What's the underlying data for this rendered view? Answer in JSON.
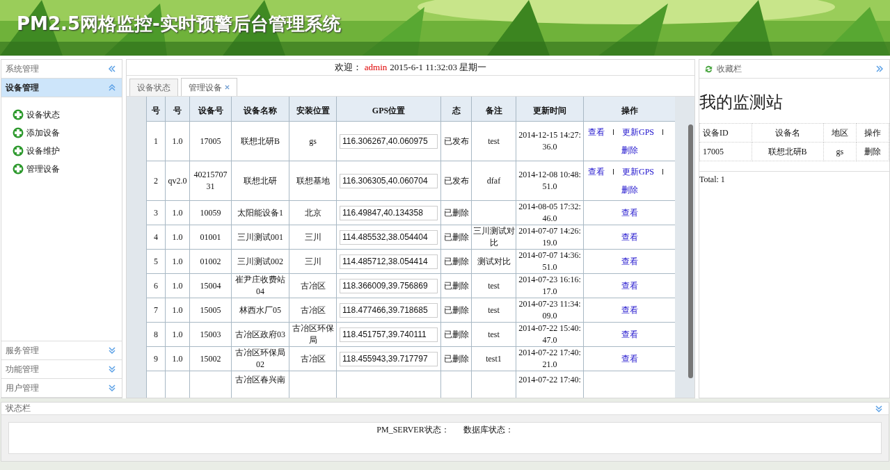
{
  "header": {
    "title": "PM2.5网格监控-实时预警后台管理系统"
  },
  "sidebar": {
    "title": "系统管理",
    "sections": [
      {
        "label": "设备管理",
        "expanded": true,
        "items": [
          "设备状态",
          "添加设备",
          "设备维护",
          "管理设备"
        ]
      },
      {
        "label": "服务管理",
        "expanded": false
      },
      {
        "label": "功能管理",
        "expanded": false
      },
      {
        "label": "用户管理",
        "expanded": false
      }
    ]
  },
  "welcome": {
    "label": "欢迎：",
    "user": "admin",
    "datetime": "2015-6-1 11:32:03 星期一"
  },
  "tabs": [
    {
      "label": "设备状态",
      "selected": false,
      "closable": false
    },
    {
      "label": "管理设备",
      "selected": true,
      "closable": true
    }
  ],
  "table": {
    "columns": [
      "号",
      "号",
      "设备号",
      "设备名称",
      "安装位置",
      "GPS位置",
      "态",
      "备注",
      "更新时间",
      "操作"
    ],
    "rows": [
      {
        "no": "1",
        "version": "1.0",
        "id": "17005",
        "name": "联想北研B",
        "location": "gs",
        "gps": "116.306267,40.060975",
        "status": "已发布",
        "remark": "test",
        "updated": "2014-12-15 14:27:36.0",
        "actions": [
          "查看",
          "更新GPS",
          "删除"
        ]
      },
      {
        "no": "2",
        "version": "qv2.0",
        "id": "4021570731",
        "name": "联想北研",
        "location": "联想基地",
        "gps": "116.306305,40.060704",
        "status": "已发布",
        "remark": "dfaf",
        "updated": "2014-12-08 10:48:51.0",
        "actions": [
          "查看",
          "更新GPS",
          "删除"
        ]
      },
      {
        "no": "3",
        "version": "1.0",
        "id": "10059",
        "name": "太阳能设备1",
        "location": "北京",
        "gps": "116.49847,40.134358",
        "status": "已删除",
        "updated": "2014-08-05 17:32:46.0",
        "actions": [
          "查看"
        ]
      },
      {
        "no": "4",
        "version": "1.0",
        "id": "01001",
        "name": "三川测试001",
        "location": "三川",
        "gps": "114.485532,38.054404",
        "status": "已删除",
        "remark": "三川测试对比",
        "updated": "2014-07-07 14:26:19.0",
        "actions": [
          "查看"
        ]
      },
      {
        "no": "5",
        "version": "1.0",
        "id": "01002",
        "name": "三川测试002",
        "location": "三川",
        "gps": "114.485712,38.054414",
        "status": "已删除",
        "remark": "测试对比",
        "updated": "2014-07-07 14:36:51.0",
        "actions": [
          "查看"
        ]
      },
      {
        "no": "6",
        "version": "1.0",
        "id": "15004",
        "name": "崔尹庄收费站04",
        "location": "古冶区",
        "gps": "118.366009,39.756869",
        "status": "已删除",
        "remark": "test",
        "updated": "2014-07-23 16:16:17.0",
        "actions": [
          "查看"
        ]
      },
      {
        "no": "7",
        "version": "1.0",
        "id": "15005",
        "name": "林西水厂05",
        "location": "古冶区",
        "gps": "118.477466,39.718685",
        "status": "已删除",
        "remark": "test",
        "updated": "2014-07-23 11:34:09.0",
        "actions": [
          "查看"
        ]
      },
      {
        "no": "8",
        "version": "1.0",
        "id": "15003",
        "name": "古冶区政府03",
        "location": "古冶区环保局",
        "gps": "118.451757,39.740111",
        "status": "已删除",
        "remark": "test",
        "updated": "2014-07-22 15:40:47.0",
        "actions": [
          "查看"
        ]
      },
      {
        "no": "9",
        "version": "1.0",
        "id": "15002",
        "name": "古冶区环保局02",
        "location": "古冶区",
        "gps": "118.455943,39.717797",
        "status": "已删除",
        "remark": "test1",
        "updated": "2014-07-22 17:40:21.0",
        "actions": [
          "查看"
        ]
      },
      {
        "name": "古冶区春兴南",
        "updated": "2014-07-22 17:40:"
      }
    ]
  },
  "favorites": {
    "title": "收藏栏",
    "heading": "我的监测站",
    "columns": [
      "设备ID",
      "设备名",
      "地区",
      "操作"
    ],
    "rows": [
      {
        "id": "17005",
        "name": "联想北研B",
        "region": "gs",
        "action": "删除"
      }
    ],
    "total": "Total: 1"
  },
  "status_bar": {
    "title": "状态栏",
    "items": [
      "PM_SERVER状态：",
      "数据库状态："
    ]
  }
}
